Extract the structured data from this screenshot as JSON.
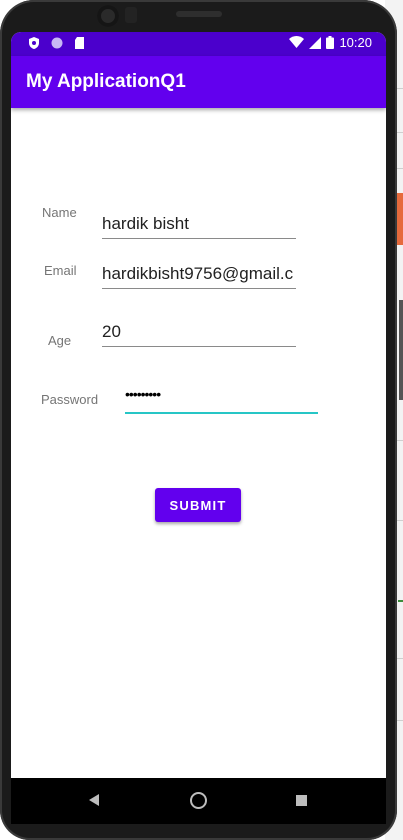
{
  "status_bar": {
    "time": "10:20",
    "left_icons": [
      "shield-icon",
      "circle-icon",
      "sd-card-icon"
    ],
    "right_icons": [
      "wifi-icon",
      "signal-icon",
      "battery-icon"
    ]
  },
  "app_bar": {
    "title": "My ApplicationQ1"
  },
  "form": {
    "name": {
      "label": "Name",
      "value": "hardik bisht"
    },
    "email": {
      "label": "Email",
      "value": "hardikbisht9756@gmail.c"
    },
    "age": {
      "label": "Age",
      "value": "20"
    },
    "password": {
      "label": "Password",
      "value": "•••••••••"
    }
  },
  "submit_label": "SUBMIT",
  "nav_bar": {
    "icons": [
      "back-icon",
      "home-icon",
      "recents-icon"
    ]
  },
  "colors": {
    "primary": "#6200ee",
    "status_bar": "#4b00cc",
    "focus_accent": "#26c6c6"
  }
}
